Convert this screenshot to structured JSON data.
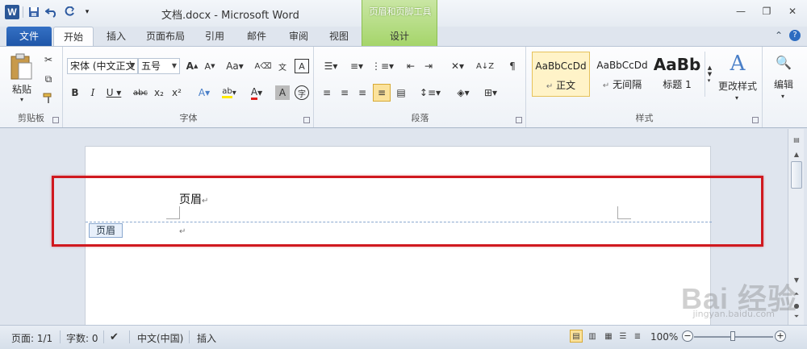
{
  "window": {
    "title": "文档.docx - Microsoft Word",
    "context_tab_title": "页眉和页脚工具"
  },
  "tabs": [
    {
      "label": "文件"
    },
    {
      "label": "开始"
    },
    {
      "label": "插入"
    },
    {
      "label": "页面布局"
    },
    {
      "label": "引用"
    },
    {
      "label": "邮件"
    },
    {
      "label": "审阅"
    },
    {
      "label": "视图"
    },
    {
      "label": "设计"
    }
  ],
  "ribbon": {
    "clipboard": {
      "paste_label": "粘贴",
      "group_label": "剪贴板"
    },
    "font": {
      "font_name": "宋体 (中文正文",
      "font_size": "五号",
      "group_label": "字体"
    },
    "paragraph": {
      "group_label": "段落"
    },
    "styles": {
      "items": [
        {
          "sample": "AaBbCcDd",
          "name": "正文"
        },
        {
          "sample": "AaBbCcDd",
          "name": "无间隔"
        },
        {
          "sample": "AaBb",
          "name": "标题 1"
        }
      ],
      "change_styles_label": "更改样式",
      "group_label": "样式"
    },
    "editing": {
      "label": "编辑"
    }
  },
  "document": {
    "header_text": "页眉",
    "header_tag": "页眉"
  },
  "statusbar": {
    "page": "页面: 1/1",
    "words": "字数: 0",
    "language": "中文(中国)",
    "insert_mode": "插入",
    "zoom": "100%"
  },
  "watermark": {
    "text": "Bai 经验",
    "sub": "jingyan.baidu.com"
  }
}
